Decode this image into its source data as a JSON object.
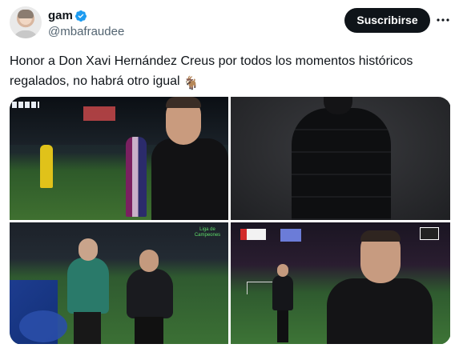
{
  "author": {
    "name": "gam",
    "handle": "@mbafraudee",
    "verified": true
  },
  "actions": {
    "subscribe_label": "Suscribirse",
    "more_icon": "more-horizontal-icon"
  },
  "tweet": {
    "text": "Honor a Don Xavi Hernández Creus por todos los momentos históricos regalados, no habrá otro igual",
    "emoji": "🐐"
  },
  "media": [
    {
      "label": ""
    },
    {
      "label": ""
    },
    {
      "label": "Liga de Campeones"
    },
    {
      "label": ""
    }
  ],
  "colors": {
    "verified_blue": "#1d9bf0",
    "button_bg": "#0f1419",
    "handle_gray": "#536471"
  }
}
